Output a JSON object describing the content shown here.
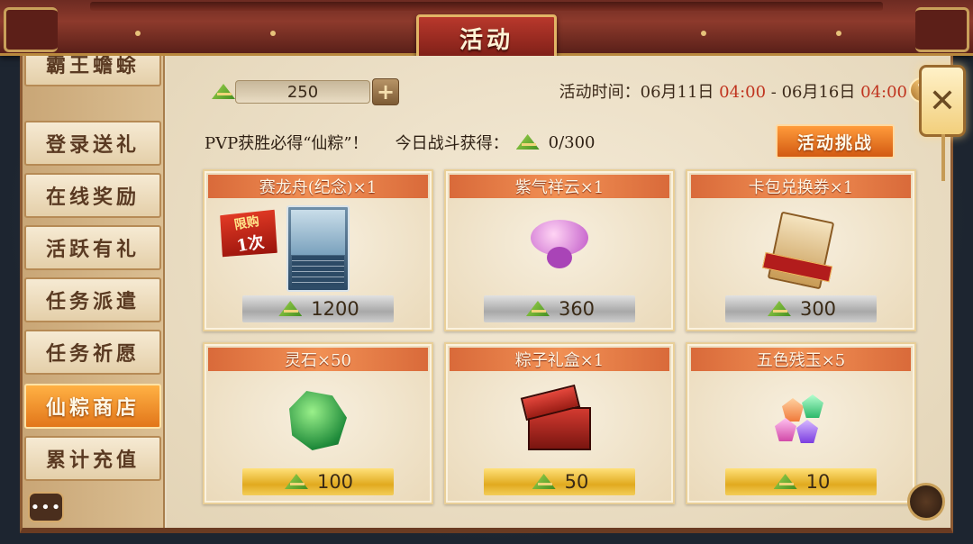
{
  "window": {
    "title": "活动"
  },
  "sidebar": {
    "items": [
      {
        "label": "霸王蟾蜍"
      },
      {
        "label": "登录送礼"
      },
      {
        "label": "在线奖励"
      },
      {
        "label": "活跃有礼"
      },
      {
        "label": "任务派遣"
      },
      {
        "label": "任务祈愿"
      },
      {
        "label": "仙粽商店",
        "active": true
      },
      {
        "label": "累计充值"
      }
    ],
    "chat_icon": "•••"
  },
  "currency": {
    "icon": "zongzi-icon",
    "value": "250",
    "plus": "+"
  },
  "event_time": {
    "label": "活动时间：",
    "start_date": "06月11日",
    "start_time": "04:00",
    "separator": " - ",
    "end_date": "06月16日",
    "end_time": "04:00"
  },
  "help_label": "?",
  "info": {
    "pvp_text": "PVP获胜必得“仙粽”！",
    "today_label": "今日战斗获得：",
    "today_count": "0/300"
  },
  "challenge_button": "活动挑战",
  "shop_items": [
    {
      "title": "赛龙舟(纪念)×1",
      "price": "1200",
      "price_style": "silver",
      "limit_a": "限购",
      "limit_b": "1次",
      "art": "card"
    },
    {
      "title": "紫气祥云×1",
      "price": "360",
      "price_style": "silver",
      "art": "cloud"
    },
    {
      "title": "卡包兑换券×1",
      "price": "300",
      "price_style": "silver",
      "art": "coupon"
    },
    {
      "title": "灵石×50",
      "price": "100",
      "price_style": "gold",
      "art": "stone"
    },
    {
      "title": "粽子礼盒×1",
      "price": "50",
      "price_style": "gold",
      "art": "box"
    },
    {
      "title": "五色残玉×5",
      "price": "10",
      "price_style": "gold",
      "art": "gems"
    }
  ],
  "close_label": "✕",
  "colors": {
    "accent_red": "#c0341f",
    "active_tab": "#e2761a",
    "title_bar": "#f19054"
  }
}
